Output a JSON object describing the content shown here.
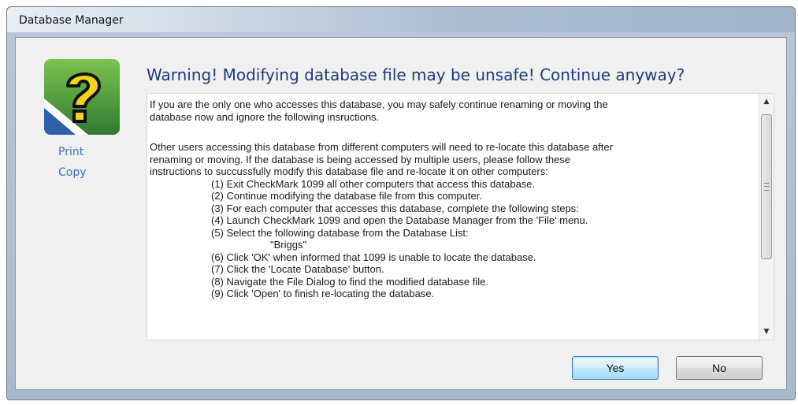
{
  "window": {
    "title": "Database Manager"
  },
  "sidebar": {
    "print_label": "Print",
    "copy_label": "Copy"
  },
  "heading": "Warning! Modifying database file may be unsafe! Continue anyway?",
  "message": {
    "para1_lines": [
      "If you are the only one who accesses this database, you may safely continue renaming or moving the",
      "database now and ignore the following insructions."
    ],
    "para2_lines": [
      "Other users accessing this database from different computers will need to re-locate this database after",
      "renaming or moving. If the database is being accessed by multiple users, please follow these",
      "instructions to succussfully modify this database file and re-locate it on other computers:"
    ],
    "steps": [
      "(1) Exit CheckMark 1099 all other computers that access this database.",
      "(2) Continue modifying the database file from this computer.",
      "(3) For each computer that accesses this database, complete the following steps:",
      "(4) Launch CheckMark 1099 and open the Database Manager from the 'File' menu.",
      "(5) Select the following database from the Database List:",
      "\"Briggs\"",
      "(6) Click 'OK' when informed that 1099 is unable to locate the database.",
      "(7) Click the 'Locate Database' button.",
      "(8) Navigate the File Dialog to find the modified database file.",
      "(9) Click 'Open' to finish re-locating the database."
    ]
  },
  "buttons": {
    "yes_label": "Yes",
    "no_label": "No"
  },
  "icons": {
    "help": "question-mark-icon",
    "scroll_up": "scroll-up-arrow-icon",
    "scroll_down": "scroll-down-arrow-icon"
  },
  "colors": {
    "heading": "#1d3a78",
    "link": "#3b6fb0",
    "icon_green": "#3f8f3a",
    "icon_yellow": "#f2d21c",
    "default_button_border": "#3c7fb1"
  }
}
